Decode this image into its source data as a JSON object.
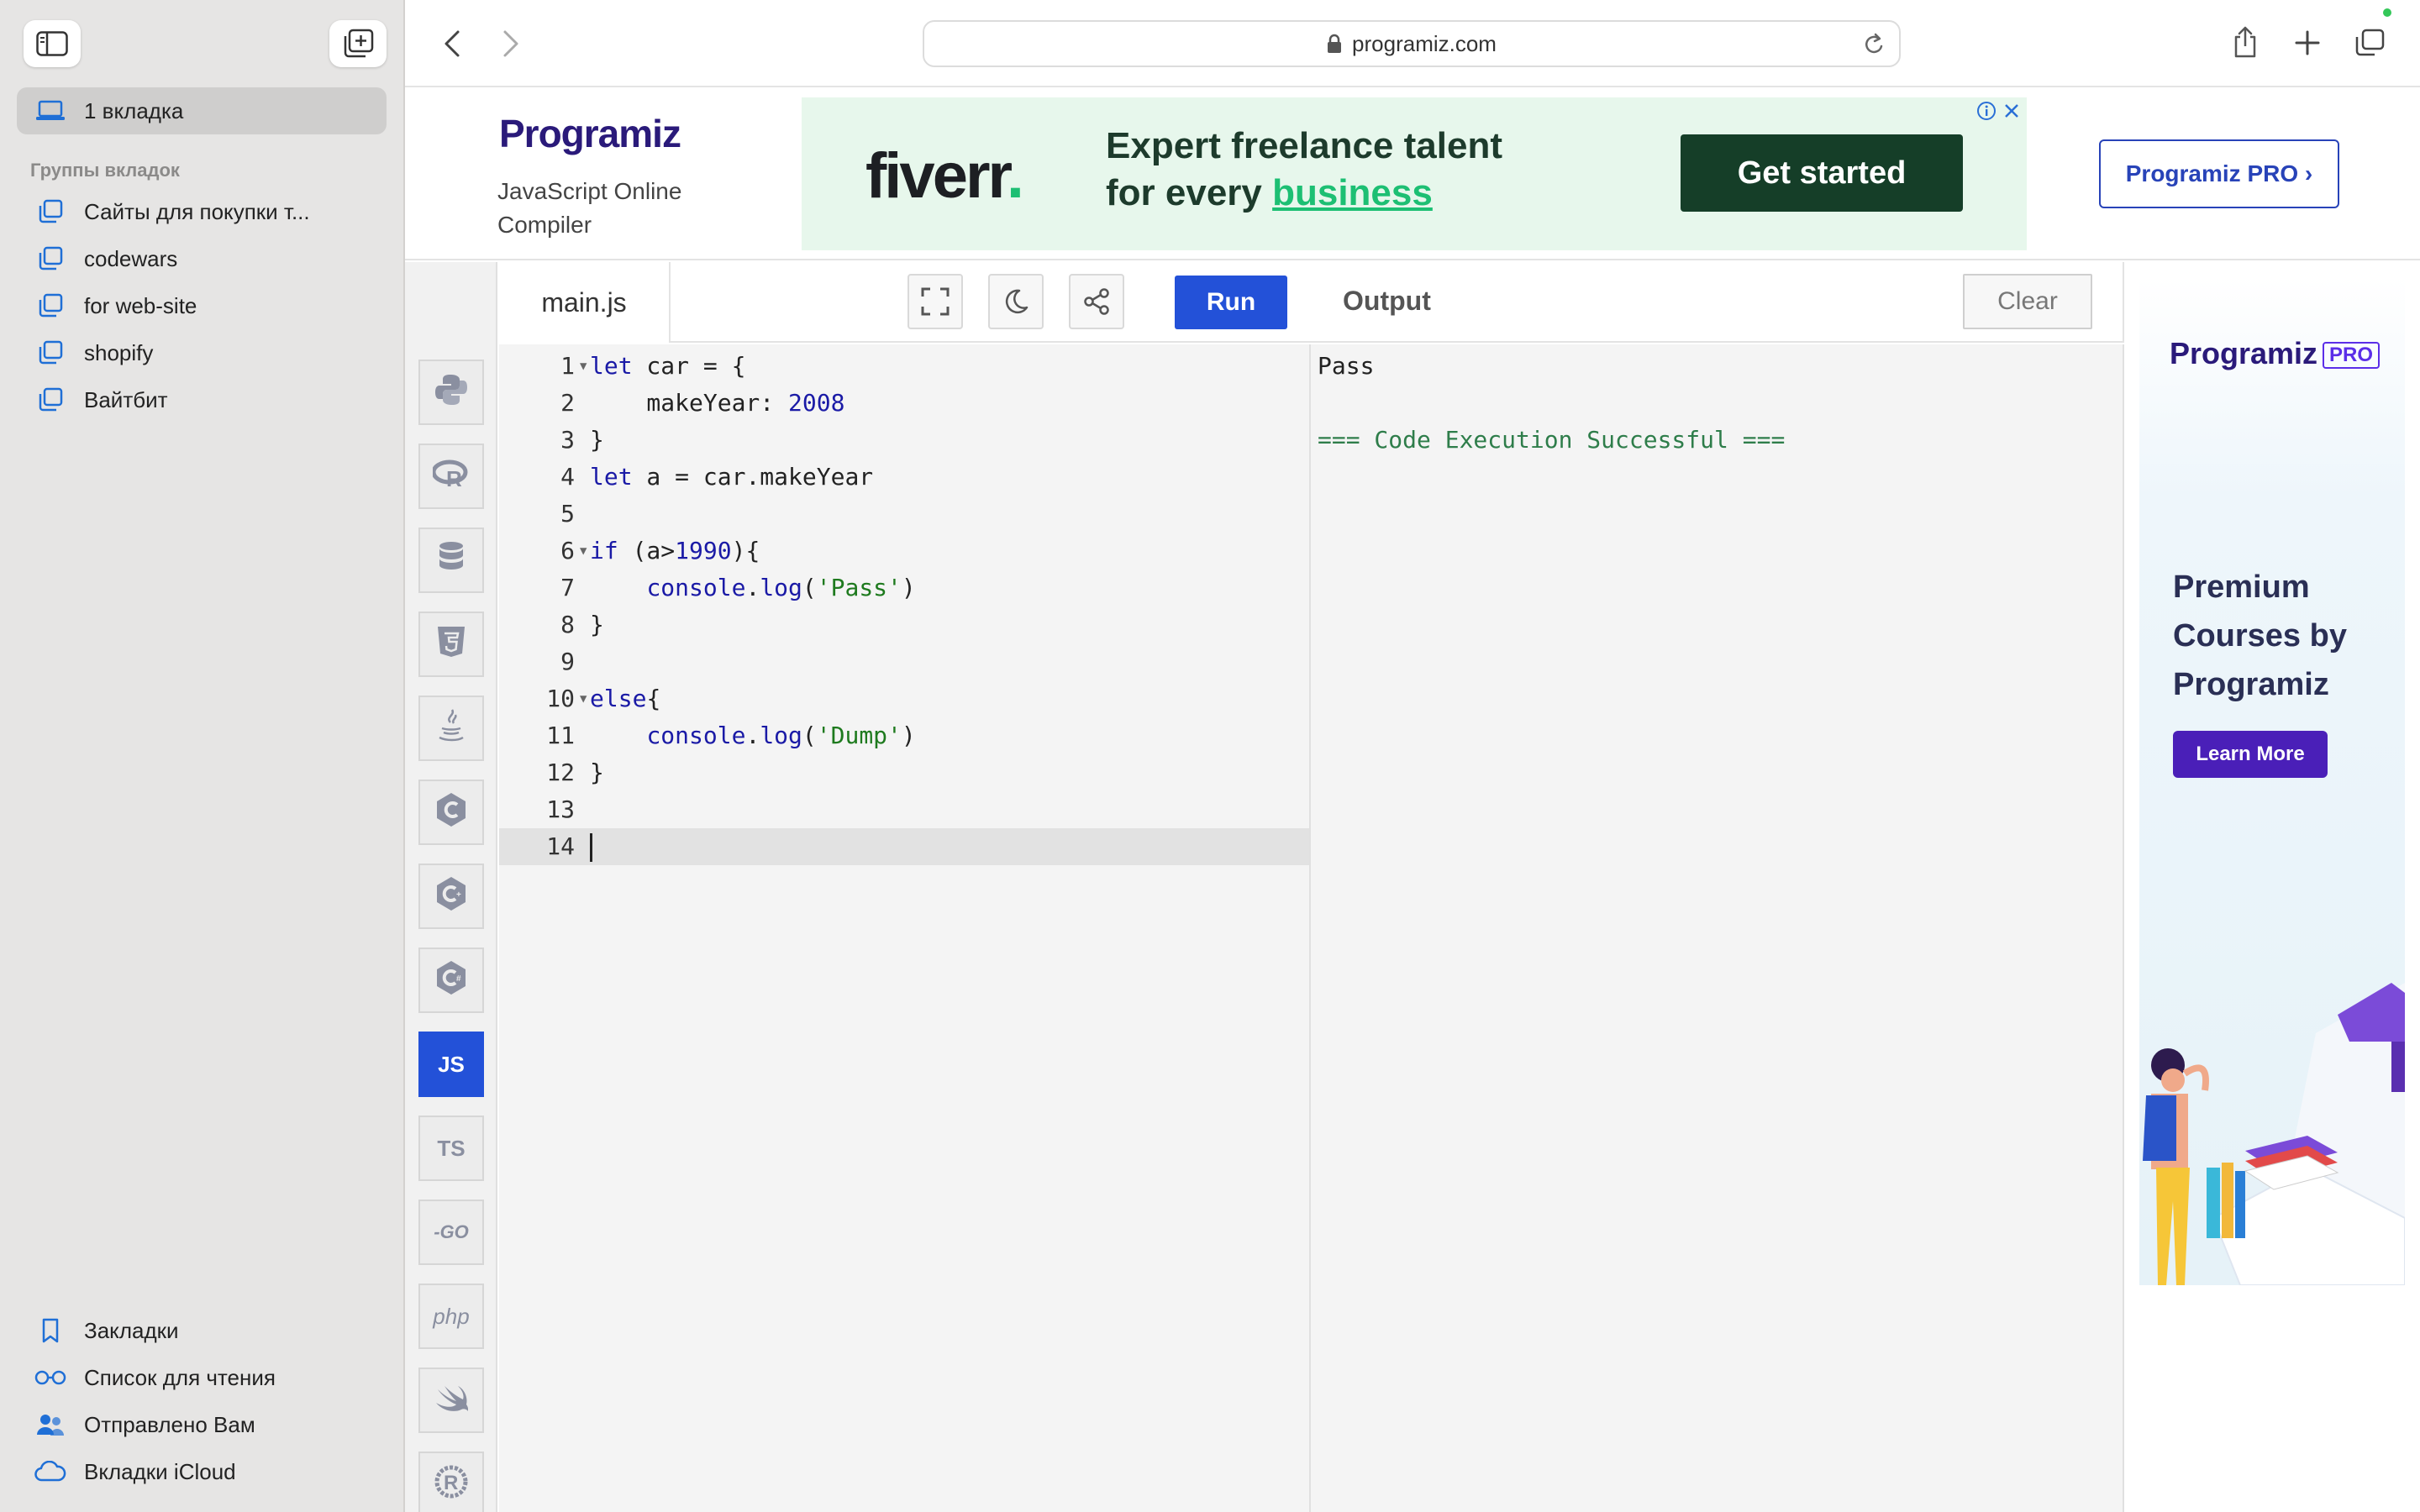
{
  "sidebar": {
    "current_tab_label": "1 вкладка",
    "groups_heading": "Группы вкладок",
    "groups": [
      {
        "label": "Сайты для покупки т..."
      },
      {
        "label": "codewars"
      },
      {
        "label": "for web-site"
      },
      {
        "label": "shopify"
      },
      {
        "label": "Вайтбит"
      }
    ],
    "bottom": [
      {
        "label": "Закладки",
        "icon": "bookmark-icon"
      },
      {
        "label": "Список для чтения",
        "icon": "reading-list-icon"
      },
      {
        "label": "Отправлено Вам",
        "icon": "shared-with-you-icon"
      },
      {
        "label": "Вкладки iCloud",
        "icon": "icloud-icon"
      }
    ]
  },
  "browser": {
    "url": "programiz.com"
  },
  "header": {
    "logo_text": "Programiz",
    "subtitle": "JavaScript Online Compiler",
    "pro_button": "Programiz PRO ›"
  },
  "ad_banner": {
    "brand": "fiverr",
    "headline_line1": "Expert freelance talent",
    "headline_line2_prefix": "for every ",
    "headline_highlight": "business",
    "cta": "Get started"
  },
  "languages": [
    {
      "name": "python-icon",
      "label": ""
    },
    {
      "name": "r-icon",
      "label": ""
    },
    {
      "name": "sql-icon",
      "label": ""
    },
    {
      "name": "html-icon",
      "label": ""
    },
    {
      "name": "java-icon",
      "label": ""
    },
    {
      "name": "c-icon",
      "label": ""
    },
    {
      "name": "cpp-icon",
      "label": ""
    },
    {
      "name": "csharp-icon",
      "label": ""
    },
    {
      "name": "js-icon",
      "label": "JS"
    },
    {
      "name": "ts-icon",
      "label": "TS"
    },
    {
      "name": "go-icon",
      "label": "-GO"
    },
    {
      "name": "php-icon",
      "label": "php"
    },
    {
      "name": "swift-icon",
      "label": ""
    },
    {
      "name": "rust-icon",
      "label": ""
    }
  ],
  "editor": {
    "file_tab": "main.js",
    "run_label": "Run",
    "lines": [
      "let car = {",
      "    makeYear: 2008",
      "}",
      "let a = car.makeYear",
      "",
      "if (a>1990){",
      "    console.log('Pass')",
      "}",
      "",
      "else{",
      "    console.log('Dump')",
      "}",
      "",
      ""
    ],
    "line_numbers": [
      "1",
      "2",
      "3",
      "4",
      "5",
      "6",
      "7",
      "8",
      "9",
      "10",
      "11",
      "12",
      "13",
      "14"
    ]
  },
  "output": {
    "title": "Output",
    "clear_label": "Clear",
    "lines": [
      "Pass",
      "",
      "=== Code Execution Successful ==="
    ]
  },
  "side_ad": {
    "logo_text": "Programiz",
    "pro_badge": "PRO",
    "headline": "Premium Courses by Programiz",
    "cta": "Learn More"
  }
}
